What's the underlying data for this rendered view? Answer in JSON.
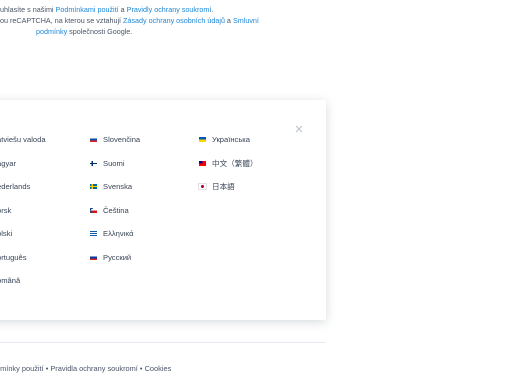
{
  "legal": {
    "line1_a": "ouhlasíte s našimi ",
    "terms_link": "Podmínkami použití",
    "line1_b": " a ",
    "privacy_link": "Pravidly ochrany soukromí",
    "line1_c": ".",
    "line2_a": "bou reCAPTCHA, na kterou se vztahují ",
    "google_privacy_link": "Zásady ochrany osobních údajů",
    "line2_b": " a ",
    "google_terms_link_a": "Smluvní",
    "google_terms_link_b": "podmínky",
    "line3_b": " společnosti Google."
  },
  "modal": {
    "close_symbol": "×",
    "columns": [
      [
        {
          "label": "atviešu valoda",
          "flag": "lv"
        },
        {
          "label": "agyar",
          "flag": "hu"
        },
        {
          "label": "ederlands",
          "flag": "nl"
        },
        {
          "label": "orsk",
          "flag": "no"
        },
        {
          "label": "olski",
          "flag": "pl"
        },
        {
          "label": "ortuguês",
          "flag": "pt"
        },
        {
          "label": "omână",
          "flag": "ro"
        }
      ],
      [
        {
          "label": "Slovenčina",
          "flag": "sk"
        },
        {
          "label": "Suomi",
          "flag": "fi"
        },
        {
          "label": "Svenska",
          "flag": "se"
        },
        {
          "label": "Čeština",
          "flag": "cz"
        },
        {
          "label": "Ελληνικά",
          "flag": "gr"
        },
        {
          "label": "Русский",
          "flag": "ru"
        }
      ],
      [
        {
          "label": "Українська",
          "flag": "ua"
        },
        {
          "label": "中文（繁體）",
          "flag": "tw"
        },
        {
          "label": "日本語",
          "flag": "jp"
        }
      ]
    ]
  },
  "footer": {
    "terms": "dmínky použití",
    "sep1": " • ",
    "privacy": "Pravidla ochrany soukromí",
    "sep2": " • ",
    "cookies": "Cookies"
  },
  "colors": {
    "link": "#1e88d8",
    "text": "#3b4658"
  }
}
